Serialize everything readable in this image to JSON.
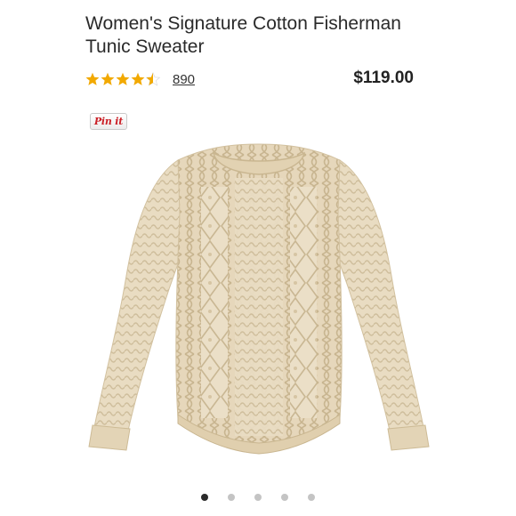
{
  "product": {
    "title": "Women's Signature Cotton Fisherman Tunic Sweater",
    "rating": 4.5,
    "rating_max": 5,
    "review_count": "890",
    "price": "$119.00"
  },
  "pin_button": {
    "label": "Pin it"
  },
  "image": {
    "alt": "Cream cable-knit fisherman tunic sweater"
  },
  "carousel": {
    "total": 5,
    "active_index": 0
  },
  "colors": {
    "star": "#f2a900",
    "sweater": "#e9dcc2",
    "pin_red": "#cb2027"
  }
}
